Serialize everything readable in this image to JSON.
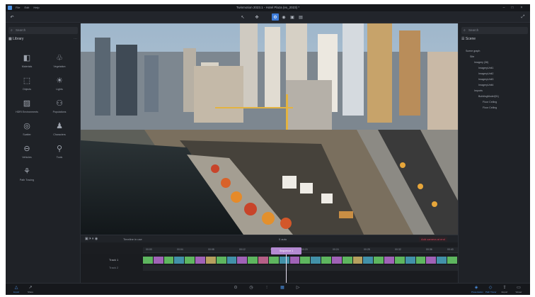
{
  "window": {
    "title": "Twinmotion 2023.1 - Hotel Plaza (ex_2023) *",
    "menu": [
      "File",
      "Edit",
      "Help"
    ]
  },
  "toolbar": {
    "icons": [
      "undo-icon",
      "cursor-icon",
      "settings-icon",
      "camera-icon",
      "view-icon",
      "layers-icon"
    ]
  },
  "left_panel": {
    "search_placeholder": "Search",
    "heading": "Library",
    "items": [
      {
        "label": "Materials",
        "icon": "materials-icon"
      },
      {
        "label": "Vegetation",
        "icon": "vegetation-icon"
      },
      {
        "label": "Objects",
        "icon": "objects-icon"
      },
      {
        "label": "Lights",
        "icon": "lights-icon"
      },
      {
        "label": "HDRI Environments",
        "icon": "hdri-icon"
      },
      {
        "label": "Populations",
        "icon": "populations-icon"
      },
      {
        "label": "Scatter",
        "icon": "scatter-icon"
      },
      {
        "label": "Characters",
        "icon": "characters-icon"
      },
      {
        "label": "Vehicles",
        "icon": "vehicles-icon"
      },
      {
        "label": "Tools",
        "icon": "tools-icon"
      },
      {
        "label": "Path Tracing",
        "icon": "path-tracing-icon"
      }
    ]
  },
  "right_panel": {
    "search_placeholder": "Search",
    "heading": "Scene",
    "tree": [
      "Scene graph",
      "Site",
      "Imagery (36)",
      "ImageryUnit1",
      "ImageryUnit2",
      "ImageryUnit3",
      "ImageryUnit4",
      "Imports",
      "BuildingModel(01)",
      "Floor Ceiling",
      "Floor Ceiling"
    ]
  },
  "timeline": {
    "sequence_label": "Timeline in use",
    "frame_label": "0 auto",
    "create_label": "Add camera at end",
    "playhead_label": "Sequence 1",
    "track1": "Track 1",
    "track2": "Track 2",
    "ruler_ticks": [
      "00:00",
      "00:04",
      "00:08",
      "00:12",
      "00:16",
      "00:20",
      "00:24",
      "00:28",
      "00:32",
      "00:36",
      "00:40"
    ],
    "clip_colors": [
      "#6bd26b",
      "#b86fd2",
      "#6bd26b",
      "#4aa6c2",
      "#6bd26b",
      "#b86fd2",
      "#d2b86b",
      "#6bd26b",
      "#4aa6c2",
      "#b86fd2",
      "#6bd26b",
      "#d26b9a",
      "#6bd26b",
      "#4aa6c2",
      "#b86fd2",
      "#6bd26b",
      "#4aa6c2",
      "#6bd26b",
      "#b86fd2",
      "#6bd26b",
      "#d2b86b",
      "#4aa6c2",
      "#6bd26b",
      "#b86fd2",
      "#6bd26b",
      "#4aa6c2",
      "#6bd26b",
      "#b86fd2",
      "#4aa6c2",
      "#6bd26b"
    ]
  },
  "bottom_bar": {
    "left": [
      {
        "label": "Import",
        "icon": "import-icon"
      },
      {
        "label": "Share",
        "icon": "share-icon"
      }
    ],
    "center_icons": [
      "camera-icon",
      "clock-icon",
      "sliders-icon",
      "media-icon",
      "video-icon"
    ],
    "right": [
      {
        "label": "Presentation",
        "icon": "presentation-icon"
      },
      {
        "label": "Path Tracer",
        "icon": "path-tracer-icon"
      },
      {
        "label": "Export",
        "icon": "export-icon"
      },
      {
        "label": "Viewer",
        "icon": "viewer-icon"
      }
    ]
  },
  "colors": {
    "accent": "#3d7bd8",
    "playhead": "#b48ad2"
  }
}
